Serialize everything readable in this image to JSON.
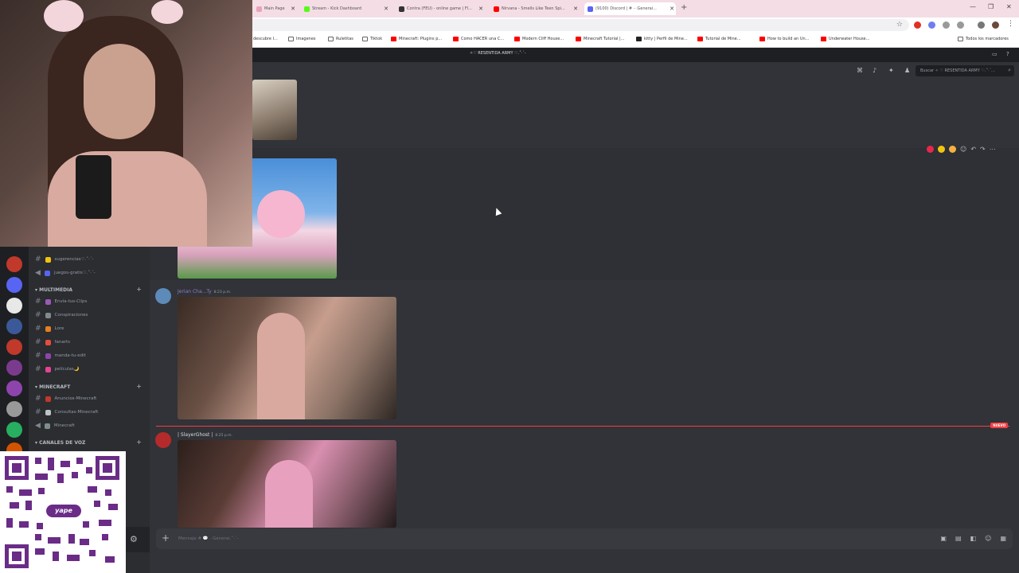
{
  "browser": {
    "tabs": [
      {
        "label": "Main Page",
        "color": "#e8a4b8"
      },
      {
        "label": "Stream - Kick Dashboard",
        "color": "#53fc18"
      },
      {
        "label": "Contra (FEU) - online game | Fl...",
        "color": "#333333"
      },
      {
        "label": "Nirvana - Smells Like Teen Spi...",
        "color": "#ff0000"
      },
      {
        "label": "(9100) Discord | # ·· Generai...",
        "color": "#5865f2"
      }
    ],
    "bookmarks": [
      {
        "label": "descubre I...",
        "type": "folder"
      },
      {
        "label": "Imagenes",
        "type": "folder"
      },
      {
        "label": "Ruletitas",
        "type": "folder"
      },
      {
        "label": "Tiktok",
        "type": "folder"
      },
      {
        "label": "Minecraft: Plugins p...",
        "type": "youtube"
      },
      {
        "label": "Como HACER una C...",
        "type": "youtube"
      },
      {
        "label": "Modern Cliff House...",
        "type": "youtube"
      },
      {
        "label": "Minecraft Tutorial |...",
        "type": "youtube"
      },
      {
        "label": "kitty | Perfil de Mine...",
        "type": "site"
      },
      {
        "label": "Tutorial de Mine...",
        "type": "youtube"
      },
      {
        "label": "How to build an Un...",
        "type": "youtube"
      },
      {
        "label": "Underwater House...",
        "type": "youtube"
      }
    ],
    "all_bookmarks": "Todos los marcadores"
  },
  "discord": {
    "title": "✧♡ RESENTIDA ARMY ♡.˚·ˊ-",
    "search_placeholder": "Buscar ✧ ♡ RESENTIDA ARMY ♡.˚·ˊ...",
    "categories": [
      {
        "label": "MULTIMEDIA",
        "channels": [
          "Envía-tus-Clips",
          "Conspiraciones",
          "Lore",
          "fanarts",
          "manda-tu-edit",
          "películas🌙"
        ]
      },
      {
        "label": "MINECRAFT",
        "channels": [
          "Anuncios-Minecraft",
          "Consultas-Minecraft",
          "Minecraft"
        ]
      },
      {
        "label": "CANALES DE VOZ",
        "channels": []
      }
    ],
    "top_channels": [
      "sugerencias♡.˚·ˊ-",
      "juegos-gratis♡.˚·ˊ-"
    ],
    "messages": [
      {
        "author": "Jerian Cha...Ty",
        "time": "8:23 p.m."
      },
      {
        "author": "| SlayerGhost |",
        "time": "8:25 p.m."
      }
    ],
    "new_label": "NUEVO",
    "composer_placeholder": "Mensaje # 💬 · Generai.˚·ˊ-"
  },
  "overlay": {
    "qr_brand": "yape"
  }
}
